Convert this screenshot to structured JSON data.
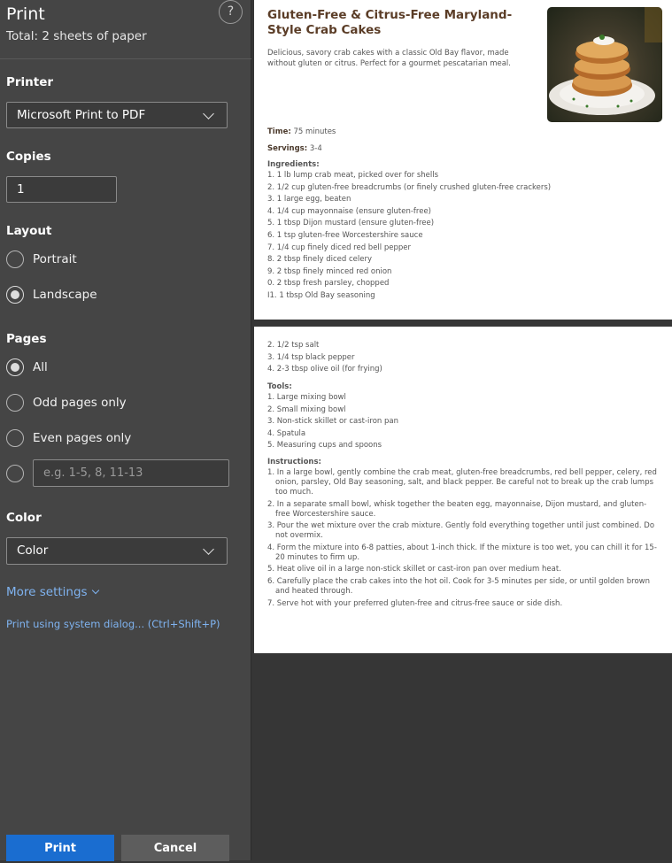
{
  "panel": {
    "title": "Print",
    "subtitle": "Total: 2 sheets of paper",
    "help_label": "?",
    "printer": {
      "label": "Printer",
      "value": "Microsoft Print to PDF"
    },
    "copies": {
      "label": "Copies",
      "value": "1"
    },
    "layout": {
      "label": "Layout",
      "options": [
        "Portrait",
        "Landscape"
      ],
      "selected": "Landscape"
    },
    "pages": {
      "label": "Pages",
      "options": [
        "All",
        "Odd pages only",
        "Even pages only"
      ],
      "selected": "All",
      "custom_placeholder": "e.g. 1-5, 8, 11-13"
    },
    "color": {
      "label": "Color",
      "value": "Color"
    },
    "more_settings": "More settings",
    "system_dialog": "Print using system dialog... (Ctrl+Shift+P)",
    "print_button": "Print",
    "cancel_button": "Cancel"
  },
  "recipe": {
    "title": "Gluten-Free & Citrus-Free Maryland-Style Crab Cakes",
    "description": "Delicious, savory crab cakes with a classic Old Bay flavor, made without gluten or citrus. Perfect for a gourmet pescatarian meal.",
    "time_label": "Time:",
    "time_value": "75 minutes",
    "servings_label": "Servings:",
    "servings_value": "3-4",
    "ingredients_label": "Ingredients:",
    "ingredients_page1": [
      "1. 1 lb lump crab meat, picked over for shells",
      "2. 1/2 cup gluten-free breadcrumbs (or finely crushed gluten-free crackers)",
      "3. 1 large egg, beaten",
      "4. 1/4 cup mayonnaise (ensure gluten-free)",
      "5. 1 tbsp Dijon mustard (ensure gluten-free)",
      "6. 1 tsp gluten-free Worcestershire sauce",
      "7. 1/4 cup finely diced red bell pepper",
      "8. 2 tbsp finely diced celery",
      "9. 2 tbsp finely minced red onion",
      "0. 2 tbsp fresh parsley, chopped",
      "I1. 1 tbsp Old Bay seasoning"
    ],
    "ingredients_page2": [
      "2. 1/2 tsp salt",
      "3. 1/4 tsp black pepper",
      "4. 2-3 tbsp olive oil (for frying)"
    ],
    "tools_label": "Tools:",
    "tools": [
      "1. Large mixing bowl",
      "2. Small mixing bowl",
      "3. Non-stick skillet or cast-iron pan",
      "4. Spatula",
      "5. Measuring cups and spoons"
    ],
    "instructions_label": "Instructions:",
    "instructions": [
      "1. In a large bowl, gently combine the crab meat, gluten-free breadcrumbs, red bell pepper, celery, red onion, parsley, Old Bay seasoning, salt, and black pepper. Be careful not to break up the crab lumps too much.",
      "2. In a separate small bowl, whisk together the beaten egg, mayonnaise, Dijon mustard, and gluten-free Worcestershire sauce.",
      "3. Pour the wet mixture over the crab mixture. Gently fold everything together until just combined. Do not overmix.",
      "4. Form the mixture into 6-8 patties, about 1-inch thick. If the mixture is too wet, you can chill it for 15-20 minutes to firm up.",
      "5. Heat olive oil in a large non-stick skillet or cast-iron pan over medium heat.",
      "6. Carefully place the crab cakes into the hot oil. Cook for 3-5 minutes per side, or until golden brown and heated through.",
      "7. Serve hot with your preferred gluten-free and citrus-free sauce or side dish."
    ]
  },
  "colors": {
    "panel_bg": "#454545",
    "preview_bg": "#363636",
    "primary": "#1a6dd0",
    "link": "#7fb3f0",
    "title_brown": "#5b3d27"
  }
}
